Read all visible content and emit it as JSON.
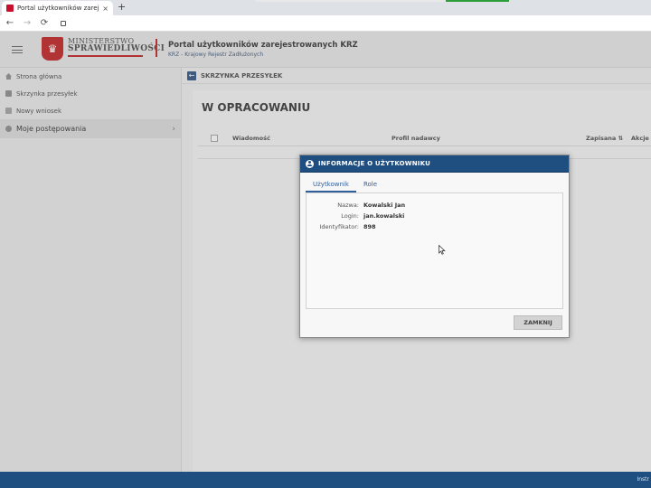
{
  "browser": {
    "tab_title": "Portal użytkowników zarejestrowanych KRZ",
    "tab_close": "×",
    "new_tab": "+",
    "back": "←",
    "forward": "→",
    "reload": "⟳"
  },
  "header": {
    "ministry_top": "MINISTERSTWO",
    "ministry_bottom": "SPRAWIEDLIWOŚCI",
    "portal_title": "Portal użytkowników zarejestrowanych KRZ",
    "portal_subtitle": "KRZ - Krajowy Rejestr Zadłużonych"
  },
  "sidebar": {
    "items": [
      {
        "label": "Strona główna",
        "icon": "home-icon"
      },
      {
        "label": "Skrzynka przesyłek",
        "icon": "inbox-icon"
      },
      {
        "label": "Nowy wniosek",
        "icon": "document-icon"
      },
      {
        "label": "Moje postępowania",
        "icon": "gear-icon",
        "chevron": "›"
      }
    ]
  },
  "main": {
    "breadcrumb": "SKRZYNKA PRZESYŁEK",
    "section_title": "W OPRACOWANIU",
    "columns": [
      "Wiadomość",
      "Profil nadawcy",
      "Zapisana ⇅",
      "Akcje"
    ]
  },
  "modal": {
    "title": "INFORMACJE O UŻYTKOWNIKU",
    "tabs": [
      "Użytkownik",
      "Role"
    ],
    "fields": [
      {
        "label": "Nazwa:",
        "value": "Kowalski Jan"
      },
      {
        "label": "Login:",
        "value": "jan.kowalski"
      },
      {
        "label": "Identyfikator:",
        "value": "898"
      }
    ],
    "close_label": "ZAMKNIJ"
  },
  "footer": {
    "text": "Instr"
  },
  "colors": {
    "primary": "#1f4f80",
    "accent_red": "#b23333",
    "link": "#2f5f9a"
  }
}
